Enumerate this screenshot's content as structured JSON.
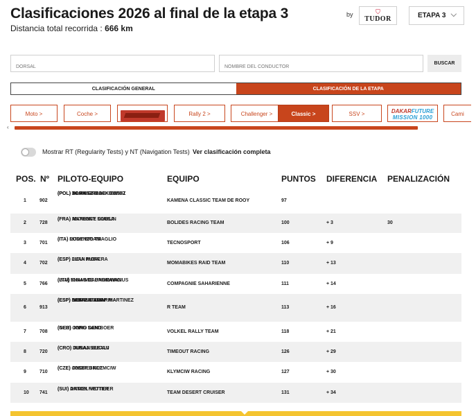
{
  "header": {
    "title": "Clasificaciones 2026 al final de la etapa 3",
    "distance_label": "Distancia total recorrida :",
    "distance_value": "666 km",
    "sponsor_by": "by",
    "sponsor_brand": "TUDOR",
    "stage_selected": "ETAPA 3"
  },
  "search": {
    "dorsal_placeholder": "DORSAL",
    "driver_placeholder": "NOMBRE DEL CONDUCTOR",
    "button_label": "BUSCAR"
  },
  "tabs": [
    {
      "label": "CLASIFICACIÓN GENERAL",
      "active": false
    },
    {
      "label": "CLASIFICACIÓN DE LA ETAPA",
      "active": true
    }
  ],
  "categories": [
    {
      "label": "Moto >",
      "active": false
    },
    {
      "label": "Coche >",
      "active": false
    },
    {
      "label": "",
      "logo": "dakar-classic-logo",
      "active": false
    },
    {
      "label": "Rally 2 >",
      "active": false
    },
    {
      "label": "Challenger >",
      "active": false
    },
    {
      "label": "Classic >",
      "active": true
    },
    {
      "label": "SSV >",
      "active": false
    },
    {
      "label": "DAKAR FUTURE MISSION 1000",
      "logo": "dakar-future-logo",
      "active": false
    },
    {
      "label": "Cami",
      "active": false
    }
  ],
  "toggle": {
    "label": "Mostrar RT (Regularity Tests) y NT (Navigation Tests)",
    "link": "Ver clasificación completa",
    "on": false
  },
  "table": {
    "headers": [
      "POS.",
      "Nº",
      "PILOTO-EQUIPO",
      "EQUIPO",
      "PUNTOS",
      "DIFERENCIA",
      "PENALIZACIÓN"
    ],
    "rows": [
      {
        "pos": "1",
        "num": "902",
        "pilots": [
          "(POL)  TOMASZ BIAŁKOWSKI",
          "(POL)  DARIUSZ BASKIEWICZ",
          "(POL)  ADAM GRODZKI"
        ],
        "team": "KAMENA CLASSIC TEAM DE ROOY",
        "points": "97",
        "diff": "",
        "penalty": ""
      },
      {
        "pos": "2",
        "num": "728",
        "pilots": [
          "(FRA)  MAXENCE GUBLIN",
          "(FRA)  ANTHONY SOUSA"
        ],
        "team": "BOLIDES RACING TEAM",
        "points": "100",
        "diff": "+ 3",
        "penalty": "30"
      },
      {
        "pos": "3",
        "num": "701",
        "pilots": [
          "(ITA)  LORENZO TRAGLIO",
          "(ITA)  RUDY BRIANI"
        ],
        "team": "TECNOSPORT",
        "points": "106",
        "diff": "+ 9",
        "penalty": ""
      },
      {
        "pos": "4",
        "num": "702",
        "pilots": [
          "(ESP)  JUAN MORERA",
          "(ESP)  LIDIA RUBA"
        ],
        "team": "MOMABIKES RAID TEAM",
        "points": "110",
        "diff": "+ 13",
        "penalty": ""
      },
      {
        "pos": "5",
        "num": "766",
        "pilots": [
          "(INA)  SHAMMIE BARIDWAN",
          "(LTU)  IGNAS DAUNORAVICIUS"
        ],
        "team": "COMPAGNIE SAHARIENNE",
        "points": "111",
        "diff": "+ 14",
        "penalty": ""
      },
      {
        "pos": "6",
        "num": "913",
        "pilots": [
          "(ESP)  JAIME \"PARRI\" MARTINEZ",
          "(ESP)  NEKANE ABIN",
          "(ESP)  IKER EXTEBARRIA"
        ],
        "team": "R TEAM",
        "points": "113",
        "diff": "+ 16",
        "penalty": ""
      },
      {
        "pos": "7",
        "num": "708",
        "pilots": [
          "(GER)  JORG SAND",
          "(NED)  ONNO DEN BOER"
        ],
        "team": "VOLKEL RALLY TEAM",
        "points": "118",
        "diff": "+ 21",
        "penalty": ""
      },
      {
        "pos": "8",
        "num": "720",
        "pilots": [
          "(CRO)  JURAJ SEBALJ",
          "(CRO)  DUSAN BUCAN"
        ],
        "team": "TIMEOUT RACING",
        "points": "126",
        "diff": "+ 29",
        "penalty": ""
      },
      {
        "pos": "9",
        "num": "710",
        "pilots": [
          "(CZE)  ONDREJ KLYMCIW",
          "(CZE)  JOSEF BROZ"
        ],
        "team": "KLYMCIW RACING",
        "points": "127",
        "diff": "+ 30",
        "penalty": ""
      },
      {
        "pos": "10",
        "num": "741",
        "pilots": [
          "(SUI)  DANIEL VETTER",
          "(SUI)  ANTON FRUTIGER"
        ],
        "team": "TEAM DESERT CRUISER",
        "points": "131",
        "diff": "+ 34",
        "penalty": ""
      }
    ]
  },
  "colors": {
    "accent": "#c8451c",
    "row_alt": "#f0f0f0",
    "bottom_bar": "#f4c430"
  }
}
